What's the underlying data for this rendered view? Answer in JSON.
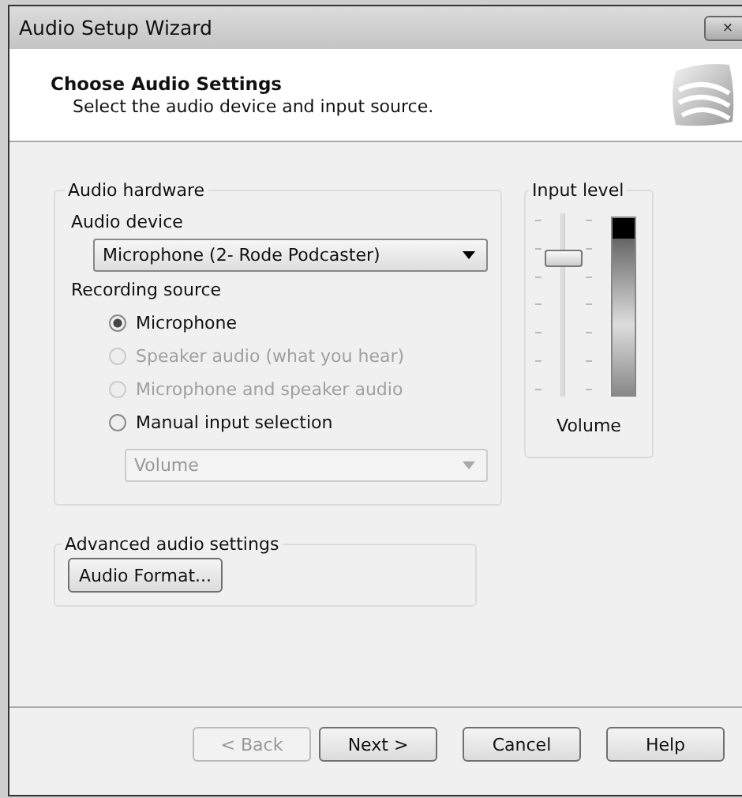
{
  "window": {
    "title": "Audio Setup Wizard",
    "close": "×"
  },
  "header": {
    "title": "Choose Audio Settings",
    "subtitle": "Select the audio device and input source."
  },
  "audio_hardware": {
    "legend": "Audio hardware",
    "device_label": "Audio device",
    "device": "Microphone (2- Rode Podcaster)",
    "source_label": "Recording source",
    "sources": [
      {
        "label": "Microphone",
        "selected": true,
        "disabled": false
      },
      {
        "label": "Speaker audio (what you hear)",
        "selected": false,
        "disabled": true
      },
      {
        "label": "Microphone and speaker audio",
        "selected": false,
        "disabled": true
      },
      {
        "label": "Manual input selection",
        "selected": false,
        "disabled": false
      }
    ],
    "input_select": {
      "value": "Volume",
      "disabled": true
    }
  },
  "input_level": {
    "legend": "Input level",
    "slider": {
      "level": 0.75
    },
    "meter": {
      "level": 0.88
    },
    "label": "Volume"
  },
  "advanced": {
    "legend": "Advanced audio settings",
    "button": "Audio Format..."
  },
  "buttons": [
    {
      "label": "< Back",
      "disabled": true
    },
    {
      "label": "Next >",
      "disabled": false
    },
    {
      "label": "Cancel",
      "disabled": false
    },
    {
      "label": "Help",
      "disabled": false
    }
  ]
}
